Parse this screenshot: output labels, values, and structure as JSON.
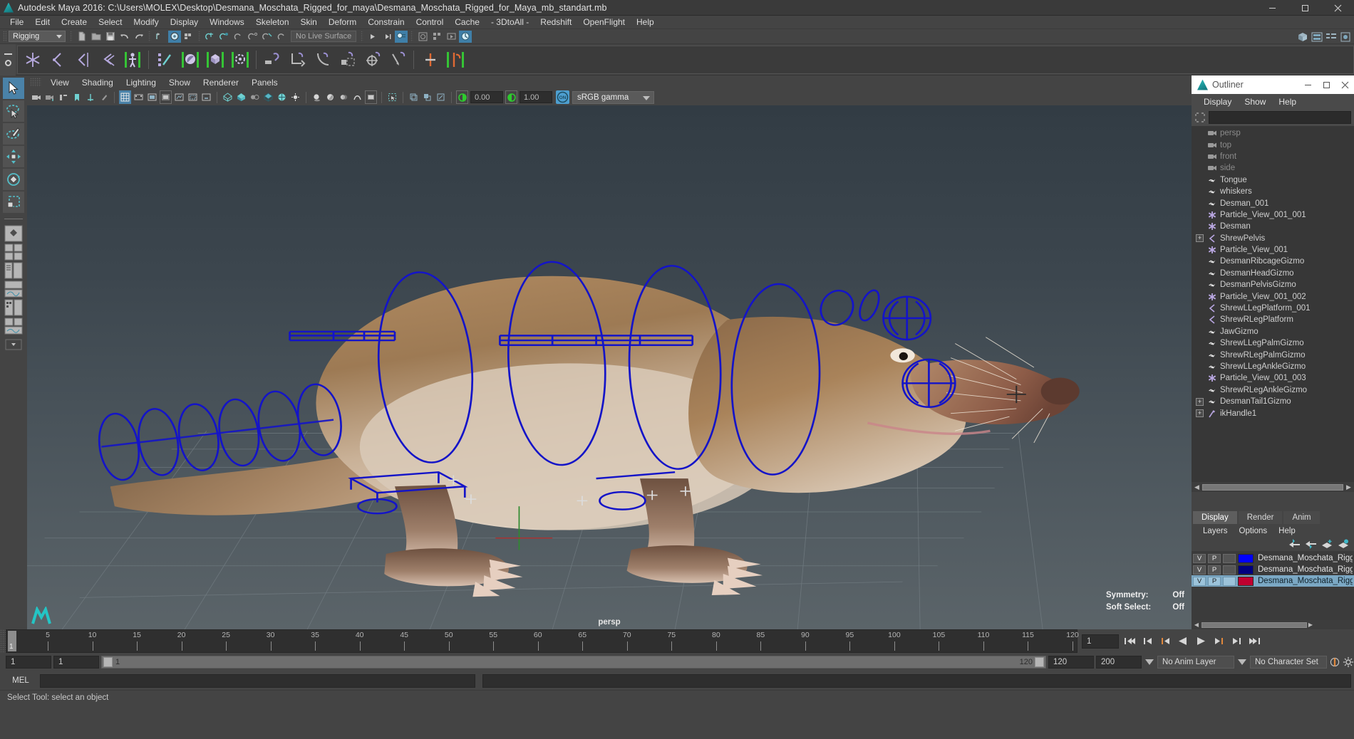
{
  "window": {
    "title": "Autodesk Maya 2016: C:\\Users\\MOLEX\\Desktop\\Desmana_Moschata_Rigged_for_maya\\Desmana_Moschata_Rigged_for_Maya_mb_standart.mb",
    "minimize": "minimize-icon",
    "maximize": "maximize-icon",
    "close": "close-icon"
  },
  "menubar": {
    "items": [
      "File",
      "Edit",
      "Create",
      "Select",
      "Modify",
      "Display",
      "Windows",
      "Skeleton",
      "Skin",
      "Deform",
      "Constrain",
      "Control",
      "Cache",
      "- 3DtoAll -",
      "Redshift",
      "OpenFlight",
      "Help"
    ]
  },
  "statusline": {
    "mode": "Rigging",
    "live_surface": "No Live Surface"
  },
  "viewport_menu": {
    "items": [
      "View",
      "Shading",
      "Lighting",
      "Show",
      "Renderer",
      "Panels"
    ]
  },
  "viewport_tools": {
    "exposure": "0.00",
    "gamma": "1.00",
    "color_toggle": "ON",
    "view_transform": "sRGB gamma"
  },
  "viewport": {
    "camera_label": "persp",
    "hud": [
      {
        "label": "Symmetry:",
        "value": "Off"
      },
      {
        "label": "Soft Select:",
        "value": "Off"
      }
    ]
  },
  "outliner": {
    "title": "Outliner",
    "menu": [
      "Display",
      "Show",
      "Help"
    ],
    "search_value": "",
    "items": [
      {
        "name": "persp",
        "icon": "camera-icon",
        "dim": true,
        "expandable": false
      },
      {
        "name": "top",
        "icon": "camera-icon",
        "dim": true,
        "expandable": false
      },
      {
        "name": "front",
        "icon": "camera-icon",
        "dim": true,
        "expandable": false
      },
      {
        "name": "side",
        "icon": "camera-icon",
        "dim": true,
        "expandable": false
      },
      {
        "name": "Tongue",
        "icon": "mesh-icon",
        "dim": false,
        "expandable": false
      },
      {
        "name": "whiskers",
        "icon": "mesh-icon",
        "dim": false,
        "expandable": false
      },
      {
        "name": "Desman_001",
        "icon": "mesh-icon",
        "dim": false,
        "expandable": false
      },
      {
        "name": "Particle_View_001_001",
        "icon": "particle-icon",
        "dim": false,
        "expandable": false
      },
      {
        "name": "Desman",
        "icon": "particle-icon",
        "dim": false,
        "expandable": false
      },
      {
        "name": "ShrewPelvis",
        "icon": "joint-icon",
        "dim": false,
        "expandable": true
      },
      {
        "name": "Particle_View_001",
        "icon": "particle-icon",
        "dim": false,
        "expandable": false
      },
      {
        "name": "DesmanRibcageGizmo",
        "icon": "mesh-icon",
        "dim": false,
        "expandable": false
      },
      {
        "name": "DesmanHeadGizmo",
        "icon": "mesh-icon",
        "dim": false,
        "expandable": false
      },
      {
        "name": "DesmanPelvisGizmo",
        "icon": "mesh-icon",
        "dim": false,
        "expandable": false
      },
      {
        "name": "Particle_View_001_002",
        "icon": "particle-icon",
        "dim": false,
        "expandable": false
      },
      {
        "name": "ShrewLLegPlatform_001",
        "icon": "joint-icon",
        "dim": false,
        "expandable": false
      },
      {
        "name": "ShrewRLegPlatform",
        "icon": "joint-icon",
        "dim": false,
        "expandable": false
      },
      {
        "name": "JawGizmo",
        "icon": "mesh-icon",
        "dim": false,
        "expandable": false
      },
      {
        "name": "ShrewLLegPalmGizmo",
        "icon": "mesh-icon",
        "dim": false,
        "expandable": false
      },
      {
        "name": "ShrewRLegPalmGizmo",
        "icon": "mesh-icon",
        "dim": false,
        "expandable": false
      },
      {
        "name": "ShrewLLegAnkleGizmo",
        "icon": "mesh-icon",
        "dim": false,
        "expandable": false
      },
      {
        "name": "Particle_View_001_003",
        "icon": "particle-icon",
        "dim": false,
        "expandable": false
      },
      {
        "name": "ShrewRLegAnkleGizmo",
        "icon": "mesh-icon",
        "dim": false,
        "expandable": false
      },
      {
        "name": "DesmanTail1Gizmo",
        "icon": "mesh-icon",
        "dim": false,
        "expandable": true
      },
      {
        "name": "ikHandle1",
        "icon": "ikhandle-icon",
        "dim": false,
        "expandable": true
      }
    ]
  },
  "layer_editor": {
    "tabs": [
      "Display",
      "Render",
      "Anim"
    ],
    "active_tab": "Display",
    "menu": [
      "Layers",
      "Options",
      "Help"
    ],
    "tool_icons": [
      "move-layer-up-icon",
      "move-layer-down-icon",
      "new-layer-icon",
      "new-layer-from-selected-icon"
    ],
    "layers": [
      {
        "v": "V",
        "p": "P",
        "third": "",
        "color": "#0000ff",
        "name": "Desmana_Moschata_Rigged_",
        "selected": false
      },
      {
        "v": "V",
        "p": "P",
        "third": "",
        "color": "#000080",
        "name": "Desmana_Moschata_Rigged_",
        "selected": false
      },
      {
        "v": "V",
        "p": "P",
        "third": "",
        "color": "#c00030",
        "name": "Desmana_Moschata_Rigged",
        "selected": true
      }
    ]
  },
  "time_slider": {
    "start": 1,
    "end": 120,
    "tick_step": 5,
    "labels": [
      5,
      10,
      15,
      20,
      25,
      30,
      35,
      40,
      45,
      50,
      55,
      60,
      65,
      70,
      75,
      80,
      85,
      90,
      95,
      100,
      105,
      110,
      115,
      120
    ],
    "current_frame_marker": "1",
    "current_frame_field": "1",
    "playback_buttons": [
      "go-to-start-icon",
      "step-back-key-icon",
      "step-back-frame-icon",
      "play-backwards-icon",
      "play-forwards-icon",
      "step-forward-frame-icon",
      "step-forward-key-icon",
      "go-to-end-icon"
    ]
  },
  "range_slider": {
    "anim_start": "1",
    "anim_end": "1",
    "range_start": "1",
    "range_end": "120",
    "playback_end": "120",
    "anim_end_field": "200",
    "anim_layer": "No Anim Layer",
    "character_set": "No Character Set"
  },
  "command_line": {
    "label": "MEL",
    "input_value": "",
    "output_value": ""
  },
  "status_bar": {
    "help_text": "Select Tool: select an object"
  },
  "colors": {
    "accent": "#4a82a8",
    "nurbs_curve": "#1414c8",
    "shelf_highlight": "#00c000",
    "panel_bg": "#444444"
  }
}
